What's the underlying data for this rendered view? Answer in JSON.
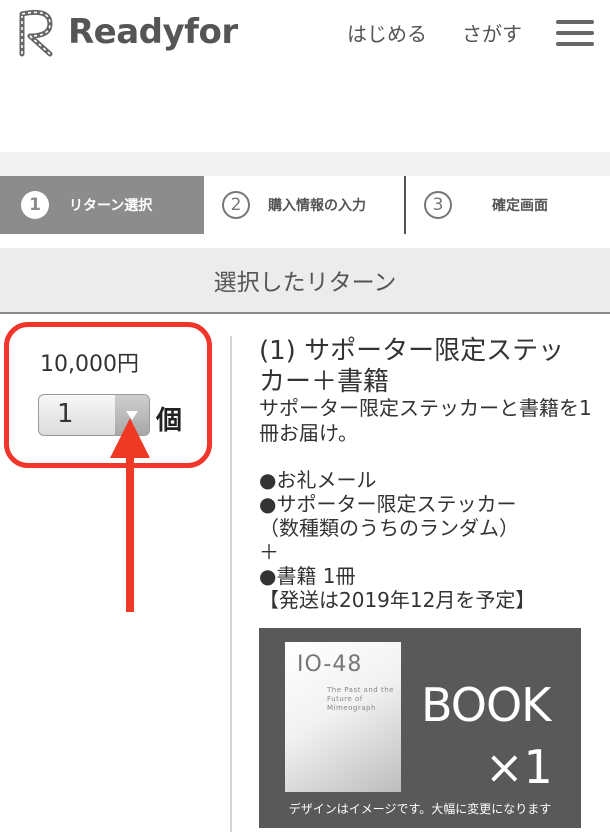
{
  "header": {
    "logo_text": "Readyfor",
    "nav_start": "はじめる",
    "nav_search": "さがす"
  },
  "steps": [
    {
      "num": "1",
      "label": "リターン選択",
      "active": true
    },
    {
      "num": "2",
      "label": "購入情報の入力",
      "active": false
    },
    {
      "num": "3",
      "label": "確定画面",
      "active": false
    }
  ],
  "section": {
    "heading": "選択したリターン"
  },
  "selection": {
    "price": "10,000円",
    "quantity": "1",
    "unit": "個"
  },
  "return_item": {
    "title": "(1) サポーター限定ステッカー＋書籍",
    "description": "サポーター限定ステッカーと書籍を1冊お届け。",
    "list": [
      "●お礼メール",
      "●サポーター限定ステッカー",
      "（数種類のうちのランダム）",
      "＋",
      "●書籍 1冊",
      "【発送は2019年12月を予定】"
    ]
  },
  "book_image": {
    "cover_title": "IO-48",
    "cover_subtitle": "The Past and the Future of Mimeograph",
    "label": "BOOK",
    "qty": "×1",
    "note": "デザインはイメージです。大幅に変更になります"
  },
  "colors": {
    "annotation_red": "#ee3a24",
    "active_step_bg": "#8c8c8c",
    "section_bg": "#ececec"
  }
}
